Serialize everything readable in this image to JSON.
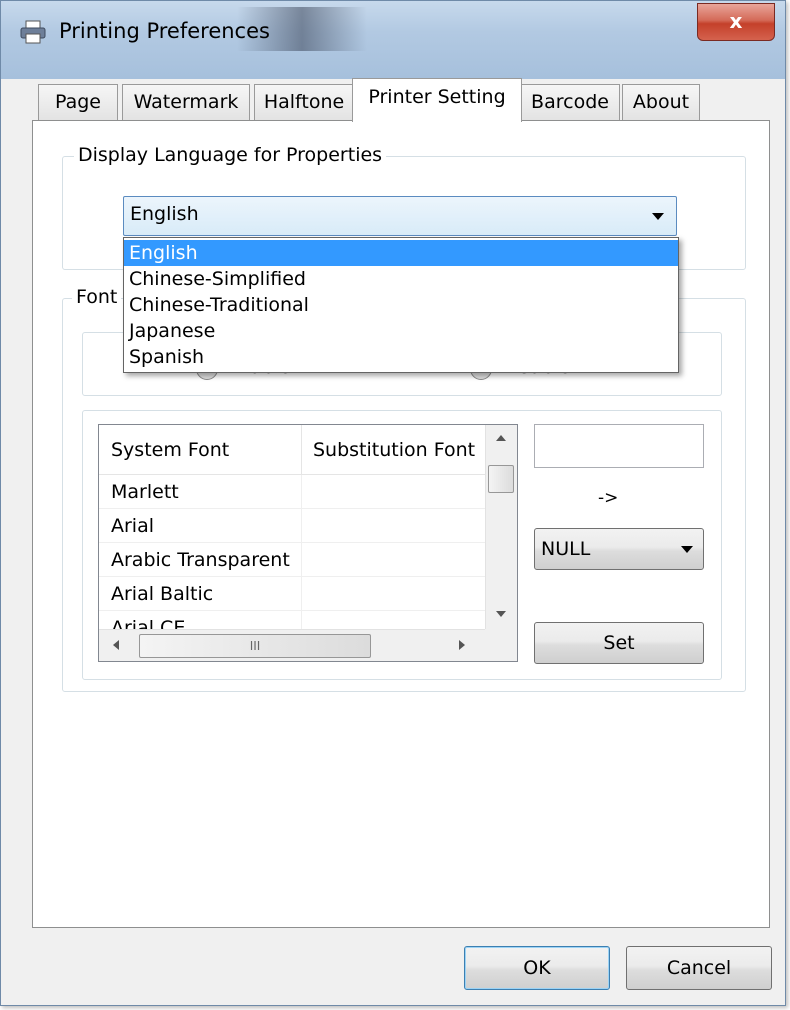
{
  "window": {
    "title": "Printing Preferences",
    "close_glyph": "x"
  },
  "tabs": [
    {
      "label": "Page"
    },
    {
      "label": "Watermark"
    },
    {
      "label": "Halftone"
    },
    {
      "label": "Printer Setting",
      "active": true
    },
    {
      "label": "Barcode"
    },
    {
      "label": "About"
    }
  ],
  "display_language": {
    "group_label": "Display Language for Properties",
    "selected": "English",
    "options": [
      "English",
      "Chinese-Simplified",
      "Chinese-Traditional",
      "Japanese",
      "Spanish"
    ]
  },
  "font_group": {
    "label_visible": "Font",
    "enable_label_partial": "Enable",
    "disable_label_partial": "Disable"
  },
  "font_table": {
    "columns": [
      "System Font",
      "Substitution Font"
    ],
    "rows": [
      {
        "system": "Marlett",
        "substitution": ""
      },
      {
        "system": "Arial",
        "substitution": ""
      },
      {
        "system": "Arabic Transparent",
        "substitution": ""
      },
      {
        "system": "Arial Baltic",
        "substitution": ""
      },
      {
        "system": "Arial CE",
        "substitution": ""
      }
    ],
    "hscroll_grip": "III"
  },
  "substitution": {
    "textbox_value": "",
    "arrow_text": "->",
    "font_select": "NULL",
    "set_label": "Set"
  },
  "footer": {
    "ok_label": "OK",
    "cancel_label": "Cancel"
  },
  "colors": {
    "selection": "#3399ff",
    "titlebar": "#b2c9e2",
    "close_button": "#c4402a"
  }
}
